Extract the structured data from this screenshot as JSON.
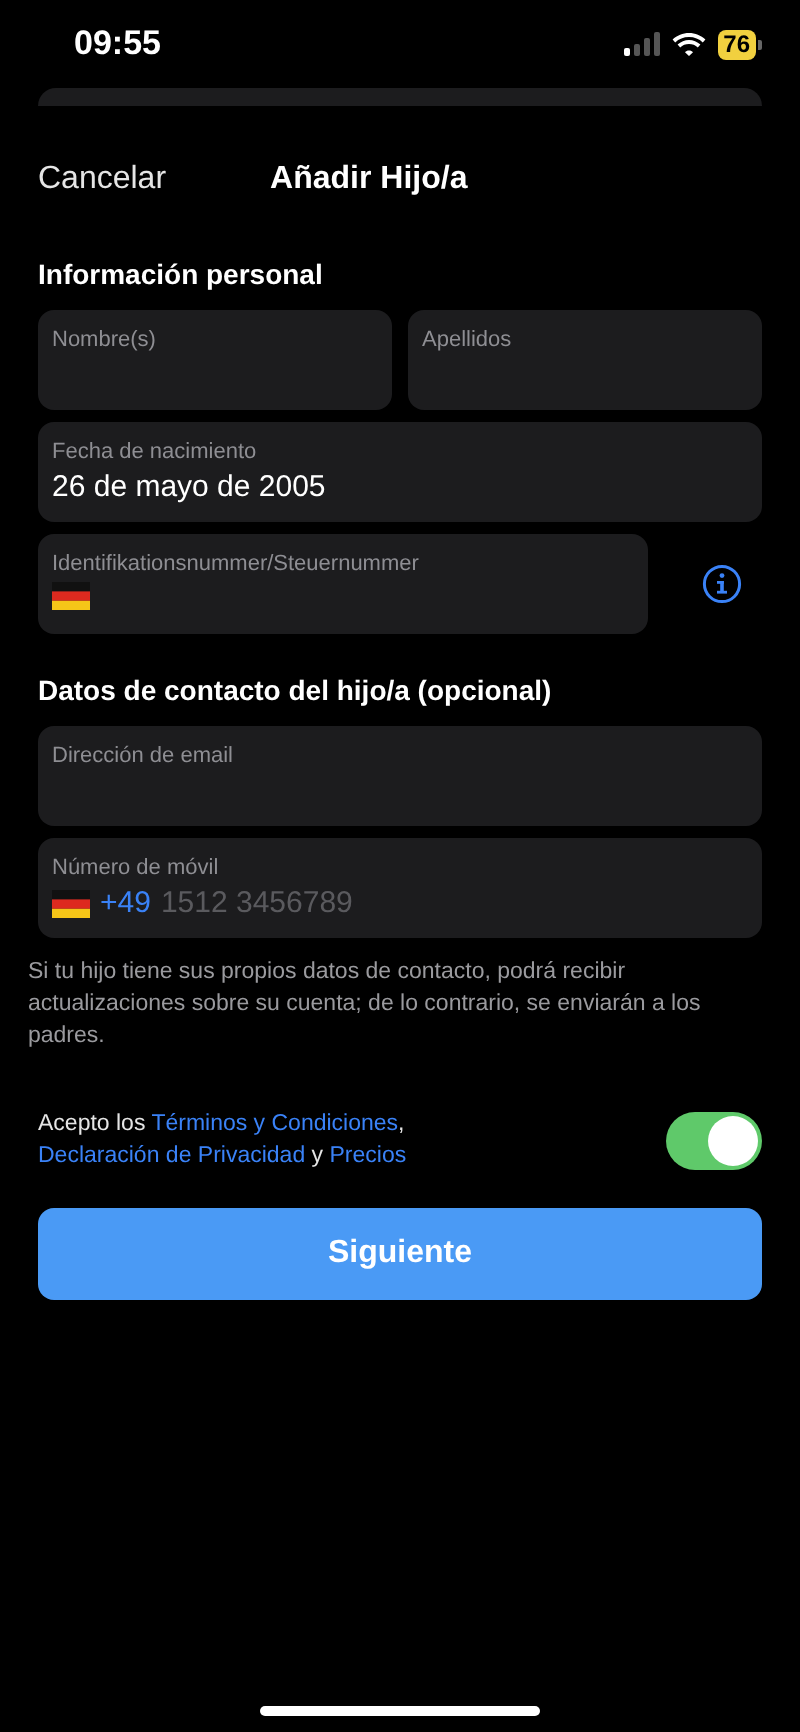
{
  "status_bar": {
    "time": "09:55",
    "battery": "76"
  },
  "nav": {
    "cancel": "Cancelar",
    "title": "Añadir Hijo/a"
  },
  "sections": [
    {
      "title": "Información personal",
      "rows": [
        [
          {
            "kind": "text",
            "label": "Nombre(s)"
          },
          {
            "kind": "text",
            "label": "Apellidos"
          }
        ],
        [
          {
            "kind": "text",
            "label": "Fecha de nacimiento",
            "value": "26 de mayo de 2005"
          }
        ],
        [
          {
            "kind": "flag",
            "label": "Identifikationsnummer/Steuernummer",
            "info": true
          }
        ]
      ]
    },
    {
      "title": "Datos de contacto del hijo/a (opcional)",
      "rows": [
        [
          {
            "kind": "text",
            "label": "Dirección de email"
          }
        ],
        [
          {
            "kind": "phone",
            "label": "Número de móvil",
            "prefix": "+49",
            "placeholder": "1512 3456789"
          }
        ]
      ]
    }
  ],
  "help_text": "Si tu hijo tiene sus propios datos de contacto, podrá recibir actualizaciones sobre su cuenta; de lo contrario, se enviarán a los padres.",
  "consent": {
    "on": true,
    "parts": [
      {
        "kind": "text",
        "text": "Acepto los "
      },
      {
        "kind": "link",
        "text": "Términos y Condiciones"
      },
      {
        "kind": "text",
        "text": ", "
      },
      {
        "kind": "link",
        "text": "Declaración de Privacidad"
      },
      {
        "kind": "text",
        "text": " y "
      },
      {
        "kind": "link",
        "text": "Precios"
      }
    ]
  },
  "button": "Siguiente"
}
